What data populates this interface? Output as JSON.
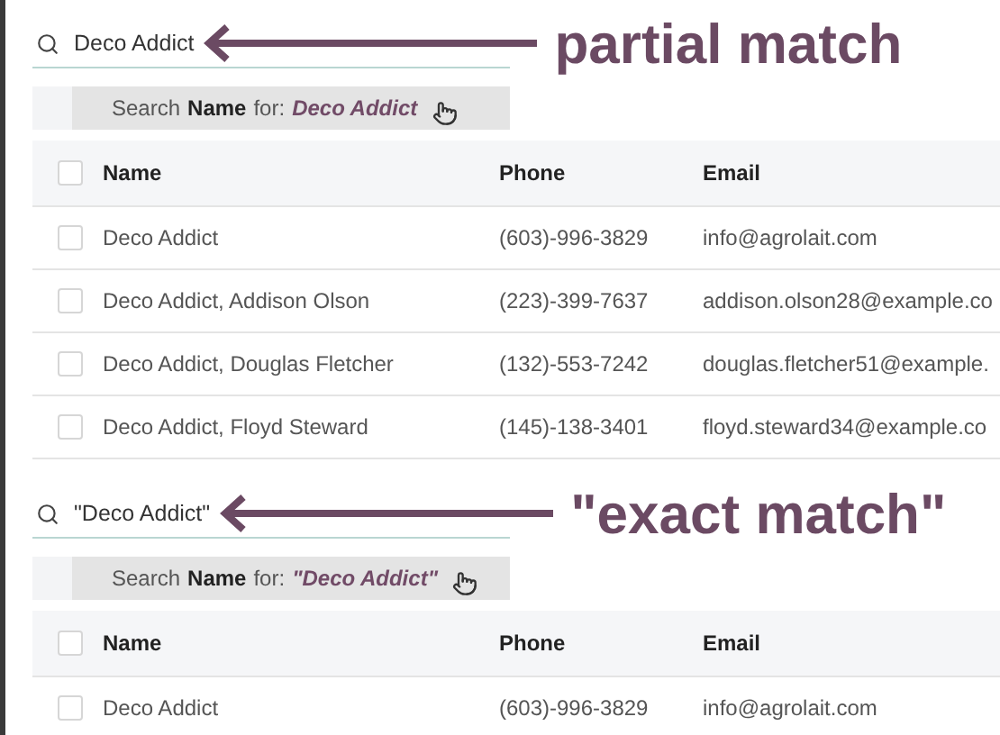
{
  "panels": [
    {
      "search": {
        "value": "Deco Addict"
      },
      "annotation": "partial match",
      "suggestion": {
        "prefix": "Search",
        "field": "Name",
        "joiner": "for:",
        "value": "Deco Addict"
      },
      "table": {
        "all_checked": false,
        "columns": [
          "Name",
          "Phone",
          "Email"
        ],
        "rows": [
          {
            "checked": false,
            "cells": [
              "Deco Addict",
              "(603)-996-3829",
              "info@agrolait.com"
            ]
          },
          {
            "checked": false,
            "cells": [
              "Deco Addict, Addison Olson",
              "(223)-399-7637",
              "addison.olson28@example.co"
            ]
          },
          {
            "checked": false,
            "cells": [
              "Deco Addict, Douglas Fletcher",
              "(132)-553-7242",
              "douglas.fletcher51@example."
            ]
          },
          {
            "checked": false,
            "cells": [
              "Deco Addict, Floyd Steward",
              "(145)-138-3401",
              "floyd.steward34@example.co"
            ]
          }
        ]
      }
    },
    {
      "search": {
        "value": "\"Deco Addict\""
      },
      "annotation": "\"exact match\"",
      "suggestion": {
        "prefix": "Search",
        "field": "Name",
        "joiner": "for:",
        "value": "\"Deco Addict\""
      },
      "table": {
        "all_checked": false,
        "columns": [
          "Name",
          "Phone",
          "Email"
        ],
        "rows": [
          {
            "checked": false,
            "cells": [
              "Deco Addict",
              "(603)-996-3829",
              "info@agrolait.com"
            ]
          }
        ]
      }
    }
  ]
}
